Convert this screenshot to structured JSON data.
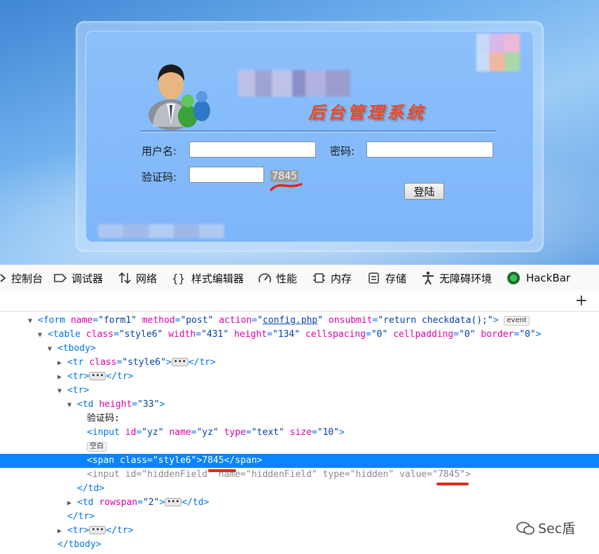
{
  "login_page": {
    "system_title": "后台管理系统",
    "username_label": "用户名:",
    "password_label": "密码:",
    "captcha_label": "验证码:",
    "captcha_text": "7845",
    "login_button": "登陆"
  },
  "devtools": {
    "tabs": [
      {
        "label": "控制台",
        "icon": "console-icon"
      },
      {
        "label": "调试器",
        "icon": "debugger-icon"
      },
      {
        "label": "网络",
        "icon": "network-icon"
      },
      {
        "label": "样式编辑器",
        "icon": "style-editor-icon"
      },
      {
        "label": "性能",
        "icon": "performance-icon"
      },
      {
        "label": "内存",
        "icon": "memory-icon"
      },
      {
        "label": "存储",
        "icon": "storage-icon"
      },
      {
        "label": "无障碍环境",
        "icon": "accessibility-icon"
      },
      {
        "label": "HackBar",
        "icon": "hackbar-icon"
      }
    ],
    "add_node": "+",
    "markup": {
      "form_tag": "form",
      "form_name_attr": "name",
      "form_name_val": "\"form1\"",
      "form_method_attr": "method",
      "form_method_val": "\"post\"",
      "form_action_attr": "action",
      "form_action_val": "config.php",
      "form_onsubmit_attr": "onsubmit",
      "form_onsubmit_val": "\"return checkdata();\"",
      "event_badge": "event",
      "table_tag": "table",
      "table_attrs": [
        {
          "name": "class",
          "value": "\"style6\""
        },
        {
          "name": "width",
          "value": "\"431\""
        },
        {
          "name": "height",
          "value": "\"134\""
        },
        {
          "name": "cellspacing",
          "value": "\"0\""
        },
        {
          "name": "cellpadding",
          "value": "\"0\""
        },
        {
          "name": "border",
          "value": "\"0\""
        }
      ],
      "tbody_open": "<tbody>",
      "tr_tag": "tr",
      "tr_class_attr": "class",
      "tr_class_val": "\"style6\"",
      "tr_close": "</tr>",
      "tr_open": "<tr>",
      "td_tag": "td",
      "td_height_attr": "height",
      "td_height_val": "\"33\"",
      "captcha_text_node": "验证码:",
      "input_tag": "input",
      "input_id_attr": "id",
      "input_id_val": "\"yz\"",
      "input_name_attr": "name",
      "input_name_val": "\"yz\"",
      "input_type_attr": "type",
      "input_type_val": "\"text\"",
      "input_size_attr": "size",
      "input_size_val": "\"10\"",
      "whitespace_badge": "空白",
      "span_tag": "span",
      "span_class_attr": "class",
      "span_class_val": "\"style6\"",
      "span_text": "7845",
      "span_close": "</span>",
      "hidden_tag": "input",
      "hidden_id_attr": "id",
      "hidden_id_val": "\"hiddenField\"",
      "hidden_name_attr": "name",
      "hidden_name_val": "\"hiddenField\"",
      "hidden_type_attr": "type",
      "hidden_type_val": "\"hidden\"",
      "hidden_value_attr": "value",
      "hidden_value_val": "\"7845\"",
      "td_close": "</td>",
      "td_rowspan_attr": "rowspan",
      "td_rowspan_val": "\"2\"",
      "tbody_close": "</tbody>"
    }
  },
  "watermark": "Sec盾"
}
